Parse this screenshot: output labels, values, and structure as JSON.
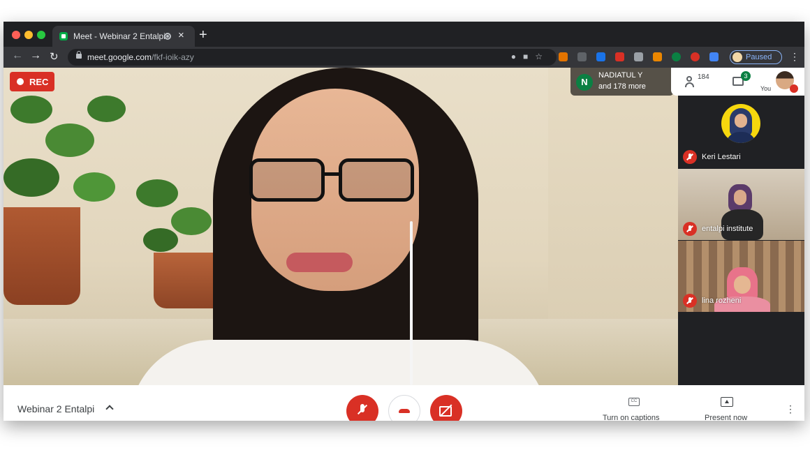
{
  "browser": {
    "tab_title": "Meet - Webinar 2 Entalpi",
    "tab_close": "×",
    "new_tab": "+",
    "url_host": "meet.google.com",
    "url_path": "/fkf-ioik-azy",
    "profile_status": "Paused",
    "extensions": [
      "#e37400",
      "#5f6368",
      "#1a73e8",
      "#d93025",
      "#9aa0a6",
      "#ea8600",
      "#0b8043",
      "#d93025",
      "#4285f4"
    ]
  },
  "meeting": {
    "rec_label": "REC",
    "active_speaker": {
      "initial": "N",
      "name": "NADIATUL Y",
      "more": "and 178 more"
    },
    "people_count": "184",
    "chat_unread": "3",
    "self_label": "You",
    "participants": [
      {
        "name": "Keri Lestari"
      },
      {
        "name": "entalpi institute"
      },
      {
        "name": "lina rozheni"
      }
    ],
    "title": "Webinar 2 Entalpi",
    "captions_label": "Turn on captions",
    "present_label": "Present now",
    "cc_glyph": "CC"
  },
  "colors": {
    "accent_red": "#d93025",
    "accent_green": "#0b8043",
    "link_blue": "#8ab4f8"
  }
}
